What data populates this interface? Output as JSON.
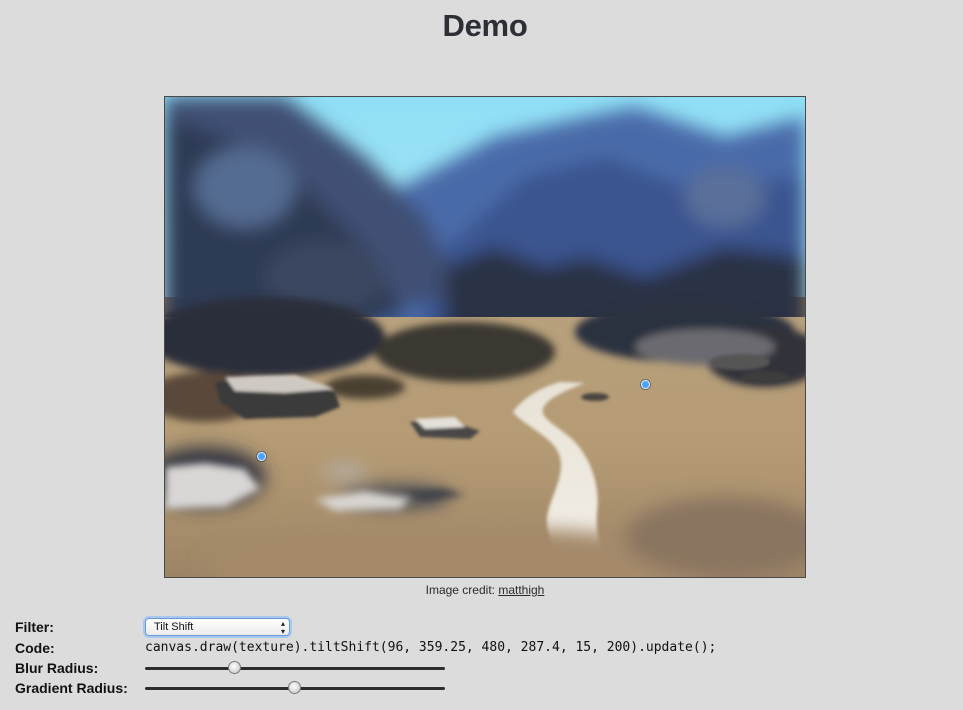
{
  "page": {
    "title": "Demo"
  },
  "credit": {
    "prefix": "Image credit: ",
    "author": "matthigh"
  },
  "controls": {
    "filter_label": "Filter:",
    "filter_selected": "Tilt Shift",
    "code_label": "Code:",
    "code": "canvas.draw(texture).tiltShift(96, 359.25, 480, 287.4, 15, 200).update();",
    "blur_label": "Blur Radius:",
    "blur_value": 0.3,
    "gradient_label": "Gradient Radius:",
    "gradient_value": 0.5
  },
  "colors": {
    "background": "#dcdcdc",
    "handle": "#4aa3ff",
    "select_focus": "#a9c8ef"
  }
}
